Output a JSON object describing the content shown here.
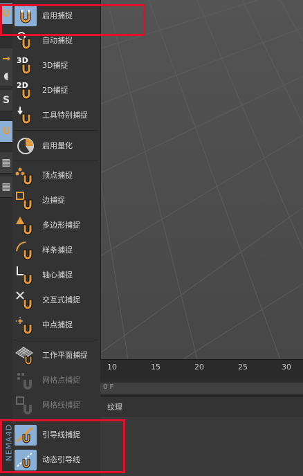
{
  "menu": {
    "enable_snap": "启用捕捉",
    "auto_snap": "自动捕捉",
    "snap_3d": "3D捕捉",
    "snap_2d": "2D捕捉",
    "tool_snap": "工具特别捕捉",
    "enable_quantize": "启用量化",
    "vertex_snap": "顶点捕捉",
    "edge_snap": "边捕捉",
    "polygon_snap": "多边形捕捉",
    "spline_snap": "样条捕捉",
    "axis_snap": "轴心捕捉",
    "intersection_snap": "交互式捕捉",
    "midpoint_snap": "中点捕捉",
    "workplane_snap": "工作平面捕捉",
    "grid_point_snap": "网格点捕捉",
    "grid_line_snap": "网格线捕捉",
    "guide_snap": "引导线捕捉",
    "dynamic_guide": "动态引导线",
    "badge_3d": "3D",
    "badge_2d": "2D"
  },
  "timeline": {
    "ticks": [
      "10",
      "15",
      "20",
      "25",
      "30"
    ],
    "frame_value": "0 F"
  },
  "bottom_tab": "纹理",
  "logo_text": "NEMA4D",
  "colors": {
    "highlight_red": "#e3102a",
    "active_blue": "#8ab0d8",
    "magnet_orange": "#e39a3b"
  }
}
